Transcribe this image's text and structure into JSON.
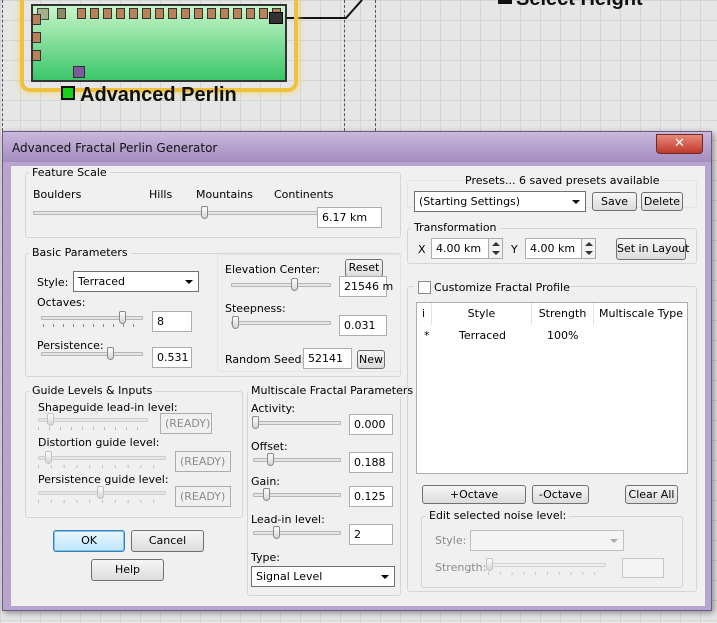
{
  "background": {
    "node_title": "Advanced Perlin",
    "other_node_title": "Select Height"
  },
  "dialog": {
    "title": "Advanced Fractal Perlin Generator",
    "close_glyph": "✕"
  },
  "feature_scale": {
    "group_label": "Feature Scale",
    "marks": [
      "Boulders",
      "Hills",
      "Mountains",
      "Continents"
    ],
    "value": "6.17 km",
    "slider_fraction": 0.58
  },
  "basic": {
    "group_label": "Basic Parameters",
    "style_label": "Style:",
    "style_value": "Terraced",
    "octaves_label": "Octaves:",
    "octaves_value": "8",
    "octaves_fraction": 0.88,
    "persistence_label": "Persistence:",
    "persistence_value": "0.531",
    "persistence_fraction": 0.69,
    "elev_label": "Elevation Center:",
    "reset_label": "Reset",
    "elev_value": "21546 m",
    "elev_fraction": 0.6,
    "steep_label": "Steepness:",
    "steep_value": "0.031",
    "steep_fraction": 0.02,
    "seed_label": "Random Seed:",
    "seed_value": "52141",
    "new_label": "New"
  },
  "guide": {
    "group_label": "Guide Levels & Inputs",
    "shape_label": "Shapeguide lead-in level:",
    "shape_value": "(READY)",
    "dist_label": "Distortion guide level:",
    "dist_value": "(READY)",
    "pers_label": "Persistence guide level:",
    "pers_value": "(READY)"
  },
  "multiscale": {
    "group_label": "Multiscale Fractal Parameters",
    "activity_label": "Activity:",
    "activity_value": "0.000",
    "offset_label": "Offset:",
    "offset_value": "0.188",
    "gain_label": "Gain:",
    "gain_value": "0.125",
    "leadin_label": "Lead-in level:",
    "leadin_value": "2",
    "type_label": "Type:",
    "type_value": "Signal Level"
  },
  "buttons": {
    "ok": "OK",
    "cancel": "Cancel",
    "help": "Help"
  },
  "presets": {
    "header": "Presets... 6 saved presets available",
    "current": "(Starting Settings)",
    "save": "Save",
    "delete": "Delete"
  },
  "transformation": {
    "group_label": "Transformation",
    "x_label": "X",
    "x_value": "4.00 km",
    "y_label": "Y",
    "y_value": "4.00 km",
    "set_layout": "Set in Layout"
  },
  "profile": {
    "checkbox_label": "Customize Fractal Profile",
    "columns": [
      "i",
      "Style",
      "Strength",
      "Multiscale Type"
    ],
    "rows": [
      {
        "i": "*",
        "style": "Terraced",
        "strength": "100%",
        "type": ""
      }
    ],
    "plus_octave": "+Octave",
    "minus_octave": "-Octave",
    "clear_all": "Clear All",
    "edit_group_label": "Edit selected noise level:",
    "edit_style_label": "Style:",
    "edit_strength_label": "Strength:"
  }
}
